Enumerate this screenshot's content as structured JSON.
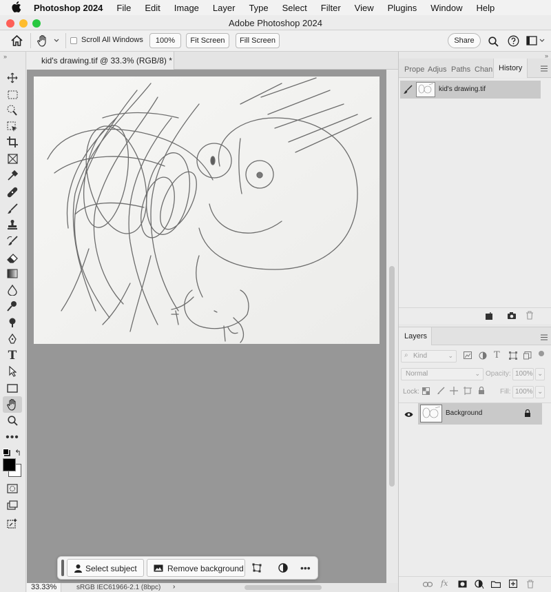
{
  "menubar": {
    "items": [
      "Photoshop 2024",
      "File",
      "Edit",
      "Image",
      "Layer",
      "Type",
      "Select",
      "Filter",
      "View",
      "Plugins",
      "Window",
      "Help"
    ]
  },
  "window": {
    "title": "Adobe Photoshop 2024"
  },
  "options_bar": {
    "scroll_all_windows": "Scroll All Windows",
    "zoom_100": "100%",
    "fit_screen": "Fit Screen",
    "fill_screen": "Fill Screen",
    "share": "Share"
  },
  "toolbox": {
    "tools": [
      "move-tool",
      "marquee-tool",
      "quick-selection-tool",
      "object-selection-tool",
      "crop-tool",
      "frame-tool",
      "eyedropper-tool",
      "spot-healing-tool",
      "brush-tool",
      "clone-stamp-tool",
      "history-brush-tool",
      "eraser-tool",
      "gradient-tool",
      "blur-tool",
      "dodge-tool",
      "burn-tool",
      "pen-tool",
      "type-tool",
      "path-selection-tool",
      "rectangle-tool",
      "hand-tool",
      "zoom-tool",
      "more-tools",
      "default-colors",
      "swap-colors",
      "quick-mask",
      "screen-mode",
      "generative-fill"
    ],
    "foreground_color": "#000000",
    "background_color": "#ffffff"
  },
  "document": {
    "tab_title": "kid's drawing.tif @ 33.3% (RGB/8) *",
    "zoom_status": "33.33%",
    "color_profile": "sRGB IEC61966-2.1 (8bpc)"
  },
  "contextual_taskbar": {
    "select_subject": "Select subject",
    "remove_background": "Remove background"
  },
  "panel_tabs": {
    "properties": "Prope",
    "adjustments": "Adjus",
    "paths": "Paths",
    "channels": "Chan",
    "history": "History"
  },
  "history": {
    "entries": [
      {
        "label": "kid's drawing.tif"
      }
    ]
  },
  "layers": {
    "tab": "Layers",
    "filter_kind": "Kind",
    "blend_mode": "Normal",
    "opacity_label": "Opacity:",
    "opacity_value": "100%",
    "lock_label": "Lock:",
    "fill_label": "Fill:",
    "fill_value": "100%",
    "items": [
      {
        "name": "Background"
      }
    ]
  },
  "colors": {
    "canvas_bg": "#979797",
    "selected_tab": "#ececec",
    "traffic_red": "#fe5f57",
    "traffic_yellow": "#febc2e",
    "traffic_green": "#28c840"
  }
}
